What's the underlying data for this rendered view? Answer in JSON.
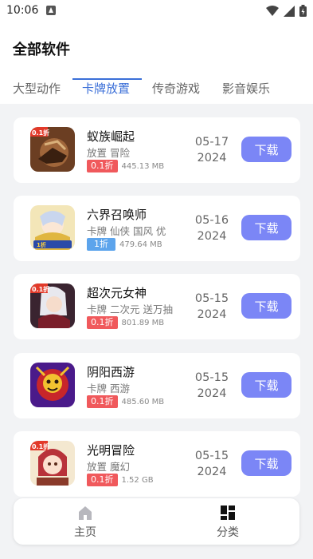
{
  "status_bar": {
    "time": "10:06"
  },
  "header": {
    "title": "全部软件"
  },
  "tabs": [
    {
      "label": "大型动作",
      "active": false
    },
    {
      "label": "卡牌放置",
      "active": true
    },
    {
      "label": "传奇游戏",
      "active": false
    },
    {
      "label": "影音娱乐",
      "active": false
    }
  ],
  "apps": [
    {
      "name": "蚁族崛起",
      "tags": "放置 冒险",
      "discount": "0.1折",
      "discount_color": "#f0595c",
      "size": "445.13 MB",
      "date_md": "05-17",
      "date_y": "2024",
      "download_label": "下载",
      "icon_badge": "0.1折"
    },
    {
      "name": "六界召唤师",
      "tags": "卡牌 仙侠 国风 优",
      "discount": "1折",
      "discount_color": "#5ca4ec",
      "size": "479.64 MB",
      "date_md": "05-16",
      "date_y": "2024",
      "download_label": "下载",
      "icon_badge": ""
    },
    {
      "name": "超次元女神",
      "tags": "卡牌 二次元 送万抽",
      "discount": "0.1折",
      "discount_color": "#f0595c",
      "size": "801.89 MB",
      "date_md": "05-15",
      "date_y": "2024",
      "download_label": "下载",
      "icon_badge": "0.1折"
    },
    {
      "name": "阴阳西游",
      "tags": "卡牌 西游",
      "discount": "0.1折",
      "discount_color": "#f0595c",
      "size": "485.60 MB",
      "date_md": "05-15",
      "date_y": "2024",
      "download_label": "下载",
      "icon_badge": ""
    },
    {
      "name": "光明冒险",
      "tags": "放置 魔幻",
      "discount": "0.1折",
      "discount_color": "#f0595c",
      "size": "1.52 GB",
      "date_md": "05-15",
      "date_y": "2024",
      "download_label": "下载",
      "icon_badge": "0.1折"
    }
  ],
  "bottom_nav": [
    {
      "label": "主页",
      "icon": "home-icon"
    },
    {
      "label": "分类",
      "icon": "category-icon"
    }
  ],
  "colors": {
    "accent": "#3b6fd8",
    "download_button": "#7b86f6",
    "discount_red": "#f0595c",
    "discount_blue": "#5ca4ec"
  }
}
